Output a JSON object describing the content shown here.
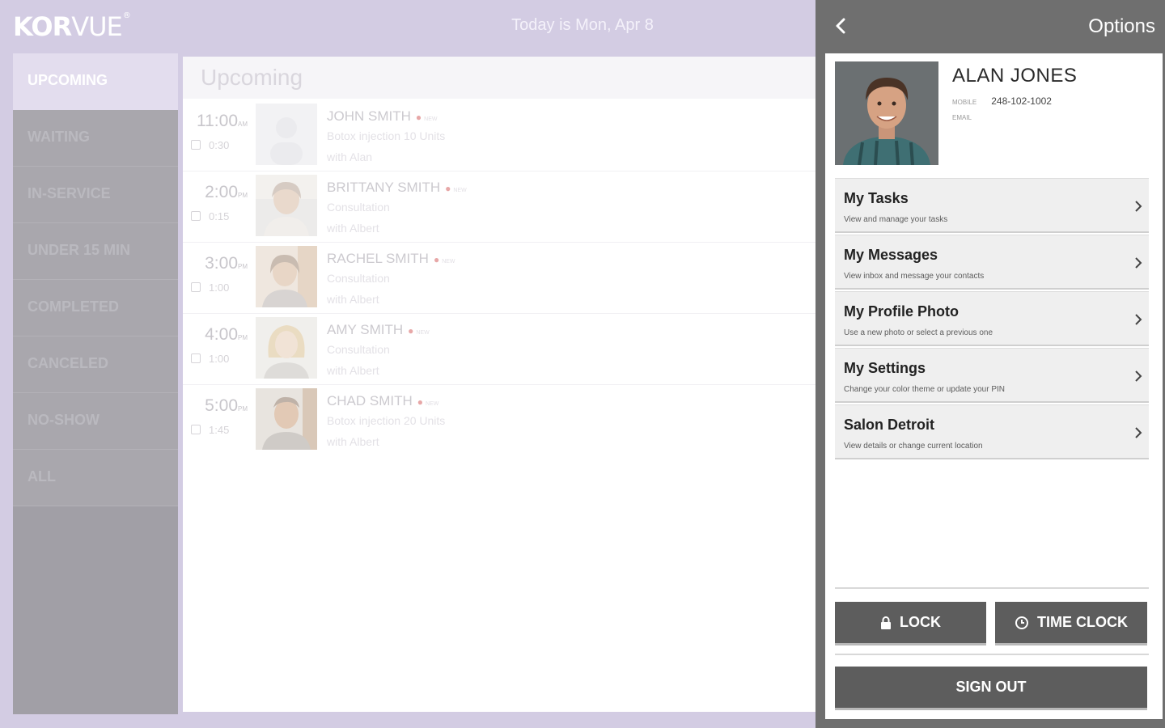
{
  "app": {
    "logo_bold": "KOR",
    "logo_light": "VUE",
    "logo_mark": "®",
    "date_text": "Today is Mon, Apr 8"
  },
  "sidebar": {
    "items": [
      {
        "label": "UPCOMING",
        "active": true
      },
      {
        "label": "WAITING"
      },
      {
        "label": "IN-SERVICE"
      },
      {
        "label": "UNDER 15 MIN"
      },
      {
        "label": "COMPLETED"
      },
      {
        "label": "CANCELED"
      },
      {
        "label": "NO-SHOW"
      },
      {
        "label": "ALL"
      }
    ]
  },
  "main": {
    "title": "Upcoming",
    "appointments": [
      {
        "time": "11:00",
        "ampm": "AM",
        "duration": "0:30",
        "name": "JOHN SMITH",
        "tag": "NEW",
        "service": "Botox injection 10 Units",
        "with": "with Alan"
      },
      {
        "time": "2:00",
        "ampm": "PM",
        "duration": "0:15",
        "name": "BRITTANY SMITH",
        "tag": "NEW",
        "service": "Consultation",
        "with": "with Albert"
      },
      {
        "time": "3:00",
        "ampm": "PM",
        "duration": "1:00",
        "name": "RACHEL SMITH",
        "tag": "NEW",
        "service": "Consultation",
        "with": "with Albert"
      },
      {
        "time": "4:00",
        "ampm": "PM",
        "duration": "1:00",
        "name": "AMY SMITH",
        "tag": "NEW",
        "service": "Consultation",
        "with": "with Albert"
      },
      {
        "time": "5:00",
        "ampm": "PM",
        "duration": "1:45",
        "name": "CHAD SMITH",
        "tag": "NEW",
        "service": "Botox injection 20 Units",
        "with": "with Albert"
      }
    ]
  },
  "panel": {
    "title": "Options",
    "user": {
      "name": "ALAN JONES",
      "mobile_label": "MOBILE",
      "mobile": "248-102-1002",
      "email_label": "EMAIL"
    },
    "menu": [
      {
        "title": "My Tasks",
        "sub": "View and manage your tasks"
      },
      {
        "title": "My Messages",
        "sub": "View inbox and message your contacts"
      },
      {
        "title": "My Profile Photo",
        "sub": "Use a new photo or select a previous one"
      },
      {
        "title": "My Settings",
        "sub": "Change your color theme or update your PIN"
      },
      {
        "title": "Salon Detroit",
        "sub": "View details or change current location"
      }
    ],
    "lock_label": "LOCK",
    "time_clock_label": "TIME CLOCK",
    "sign_out_label": "SIGN OUT"
  }
}
